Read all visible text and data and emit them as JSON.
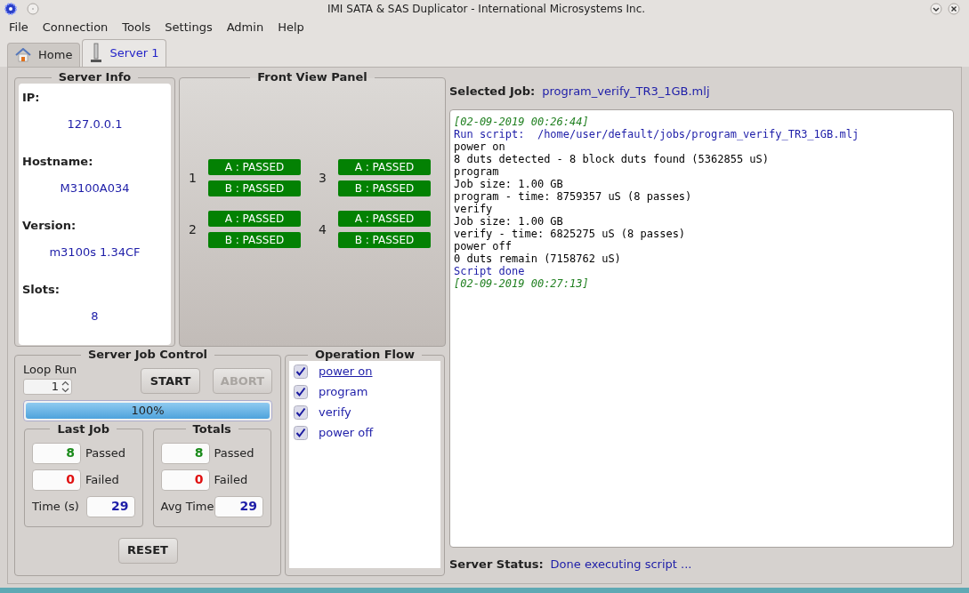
{
  "window": {
    "title": "IMI SATA & SAS Duplicator - International Microsystems Inc."
  },
  "menu": [
    "File",
    "Connection",
    "Tools",
    "Settings",
    "Admin",
    "Help"
  ],
  "tabs": [
    {
      "label": "Home",
      "kind": "home",
      "selected": false
    },
    {
      "label": "Server 1",
      "kind": "server",
      "selected": true
    }
  ],
  "server_info": {
    "title": "Server Info",
    "fields": [
      {
        "label": "IP:",
        "value": "127.0.0.1"
      },
      {
        "label": "Hostname:",
        "value": "M3100A034"
      },
      {
        "label": "Version:",
        "value": "m3100s 1.34CF"
      },
      {
        "label": "Slots:",
        "value": "8"
      }
    ]
  },
  "front_view_panel": {
    "title": "Front View Panel",
    "slots": [
      {
        "number": "1",
        "ports": [
          {
            "text": "A : PASSED",
            "kind": "passed"
          },
          {
            "text": "B : PASSED",
            "kind": "passed"
          }
        ]
      },
      {
        "number": "3",
        "ports": [
          {
            "text": "A : PASSED",
            "kind": "passed"
          },
          {
            "text": "B : PASSED",
            "kind": "passed"
          }
        ]
      },
      {
        "number": "2",
        "ports": [
          {
            "text": "A : PASSED",
            "kind": "passed"
          },
          {
            "text": "B : PASSED",
            "kind": "passed"
          }
        ]
      },
      {
        "number": "4",
        "ports": [
          {
            "text": "A : PASSED",
            "kind": "passed"
          },
          {
            "text": "B : PASSED",
            "kind": "passed"
          }
        ]
      }
    ]
  },
  "job_control": {
    "title": "Server Job Control",
    "loop_run_label": "Loop Run",
    "loop_run_value": "1",
    "buttons": [
      {
        "label": "START",
        "disabled": false
      },
      {
        "label": "ABORT",
        "disabled": true
      }
    ],
    "progress": {
      "level": 1,
      "text": "100%"
    },
    "last_job": {
      "title": "Last Job",
      "passed": "8",
      "passed_label": "Passed",
      "failed": "0",
      "failed_label": "Failed",
      "time_label": "Time (s)",
      "time": "29"
    },
    "totals": {
      "title": "Totals",
      "passed": "8",
      "passed_label": "Passed",
      "failed": "0",
      "failed_label": "Failed",
      "time_label": "Avg Time",
      "time": "29"
    },
    "reset_label": "RESET"
  },
  "operation_flow": {
    "title": "Operation Flow",
    "items": [
      {
        "label": "power on",
        "checked": true,
        "selected": true
      },
      {
        "label": "program",
        "checked": true,
        "selected": false
      },
      {
        "label": "verify",
        "checked": true,
        "selected": false
      },
      {
        "label": "power off",
        "checked": true,
        "selected": false
      }
    ]
  },
  "selected_job": {
    "label": "Selected Job:",
    "value": "program_verify_TR3_1GB.mlj"
  },
  "log": [
    {
      "kind": "timestamp",
      "text": "[02-09-2019 00:26:44]"
    },
    {
      "kind": "info",
      "text": "Run script:  /home/user/default/jobs/program_verify_TR3_1GB.mlj"
    },
    {
      "kind": "plain",
      "text": "power on"
    },
    {
      "kind": "plain",
      "text": "8 duts detected - 8 block duts found (5362855 uS)"
    },
    {
      "kind": "plain",
      "text": "program"
    },
    {
      "kind": "plain",
      "text": "Job size: 1.00 GB"
    },
    {
      "kind": "plain",
      "text": "program - time: 8759357 uS (8 passes)"
    },
    {
      "kind": "plain",
      "text": "verify"
    },
    {
      "kind": "plain",
      "text": "Job size: 1.00 GB"
    },
    {
      "kind": "plain",
      "text": "verify - time: 6825275 uS (8 passes)"
    },
    {
      "kind": "plain",
      "text": "power off"
    },
    {
      "kind": "plain",
      "text": "0 duts remain (7158762 uS)"
    },
    {
      "kind": "info",
      "text": "Script done"
    },
    {
      "kind": "timestamp",
      "text": "[02-09-2019 00:27:13]"
    }
  ],
  "status": {
    "label": "Server Status:",
    "value": "Done executing script ..."
  }
}
